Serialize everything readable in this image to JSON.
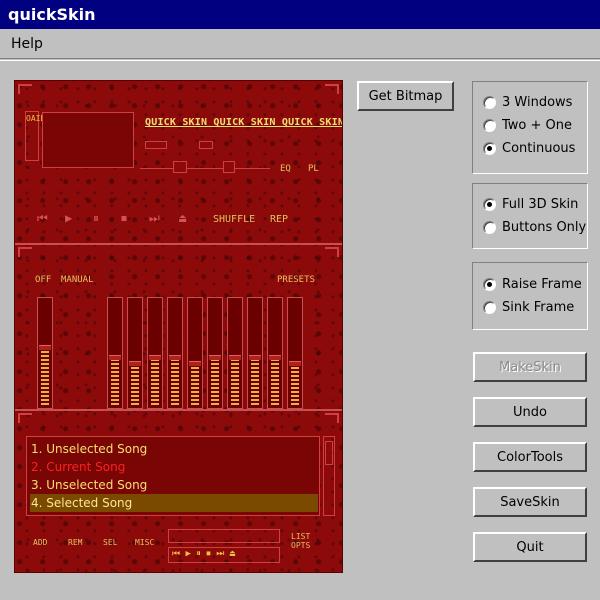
{
  "window": {
    "title": "quickSkin"
  },
  "menu": {
    "items": [
      "Help"
    ]
  },
  "skin": {
    "vertical_text": "OAIDO",
    "marquee": "QUICK SKIN  QUICK SKIN  QUICK SKIN",
    "eq_label": "EQ",
    "pl_label": "PL",
    "shuffle_label": "SHUFFLE",
    "rep_label": "REP",
    "off_label": "OFF",
    "manual_label": "MANUAL",
    "presets_label": "PRESETS",
    "playlist": [
      {
        "text": "1. Unselected Song",
        "state": "unselected"
      },
      {
        "text": "2. Current Song",
        "state": "current"
      },
      {
        "text": "3. Unselected Song",
        "state": "unselected"
      },
      {
        "text": "4. Selected Song",
        "state": "selected"
      }
    ],
    "bottom_buttons": [
      "ADD",
      "REM",
      "SEL",
      "MISC"
    ],
    "list_opts": "LIST OPTS",
    "transport_glyphs": "⏮ ▶ ⏸ ⏹ ⏭ ⏏",
    "eq_levels": [
      0.55,
      0.45,
      0.4,
      0.45,
      0.45,
      0.4,
      0.45,
      0.45,
      0.45,
      0.45,
      0.4
    ]
  },
  "buttons": {
    "get_bitmap": "Get Bitmap",
    "make_skin": "MakeSkin",
    "undo": "Undo",
    "color_tools": "ColorTools",
    "save_skin": "SaveSkin",
    "quit": "Quit"
  },
  "layout_group": {
    "options": [
      "3 Windows",
      "Two + One",
      "Continuous"
    ],
    "selected": 2
  },
  "skin_group": {
    "options": [
      "Full 3D Skin",
      "Buttons Only"
    ],
    "selected": 0
  },
  "frame_group": {
    "options": [
      "Raise Frame",
      "Sink Frame"
    ],
    "selected": 0
  },
  "colors": {
    "titlebar": "#000080",
    "skin_bg": "#8c0a0a",
    "accent_yellow": "#f6e070",
    "current_song": "#ff2020"
  }
}
